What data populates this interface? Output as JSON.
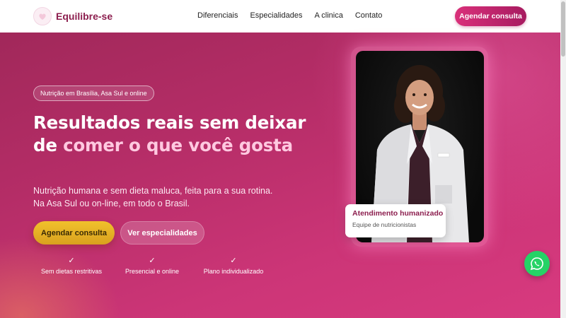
{
  "header": {
    "brand_name": "Equilibre-se",
    "nav": [
      "Diferenciais",
      "Especialidades",
      "A clinica",
      "Contato"
    ],
    "cta_label": "Agendar consulta"
  },
  "hero": {
    "badge": "Nutrição em Brasília, Asa Sul e online",
    "headline_part1": "Resultados reais sem deixar de ",
    "headline_highlight": "comer o que você gosta",
    "subtext": "Nutrição humana e sem dieta maluca, feita para a sua rotina. Na Asa Sul ou on-line, em todo o Brasil.",
    "primary_button": "Agendar consulta",
    "secondary_button": "Ver especialidades",
    "features": [
      {
        "icon": "check-icon",
        "label": "Sem dietas restritivas"
      },
      {
        "icon": "check-icon",
        "label": "Presencial e online"
      },
      {
        "icon": "check-icon",
        "label": "Plano individualizado"
      }
    ]
  },
  "photo_card": {
    "title": "Atendimento humanizado",
    "subtitle": "Equipe de nutricionistas"
  },
  "colors": {
    "brand": "#8c1e4e",
    "cta_gradient_start": "#d9307a",
    "primary_button": "#f1c12c",
    "highlight_text": "#ffc9e0",
    "whatsapp": "#25d366"
  }
}
